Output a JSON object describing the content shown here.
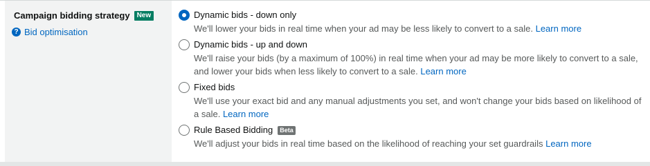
{
  "field": {
    "label": "Campaign bidding strategy",
    "badge": "New",
    "help_link": "Bid optimisation",
    "help_icon": "?"
  },
  "options": [
    {
      "title": "Dynamic bids - down only",
      "description": "We'll lower your bids in real time when your ad may be less likely to convert to a sale.",
      "link": "Learn more",
      "selected": true
    },
    {
      "title": "Dynamic bids - up and down",
      "description": "We'll raise your bids (by a maximum of 100%) in real time when your ad may be more likely to convert to a sale, and lower your bids when less likely to convert to a sale.",
      "link": "Learn more",
      "selected": false
    },
    {
      "title": "Fixed bids",
      "description": "We'll use your exact bid and any manual adjustments you set, and won't change your bids based on likelihood of a sale.",
      "link": "Learn more",
      "selected": false
    },
    {
      "title": "Rule Based Bidding",
      "badge": "Beta",
      "description": "We'll adjust your bids in real time based on the likelihood of reaching your set guardrails",
      "link": "Learn more",
      "selected": false
    }
  ],
  "colors": {
    "accent": "#0066c0",
    "new_badge": "#067d62",
    "beta_badge": "#6f7373",
    "left_pane": "#f2f3f3"
  }
}
